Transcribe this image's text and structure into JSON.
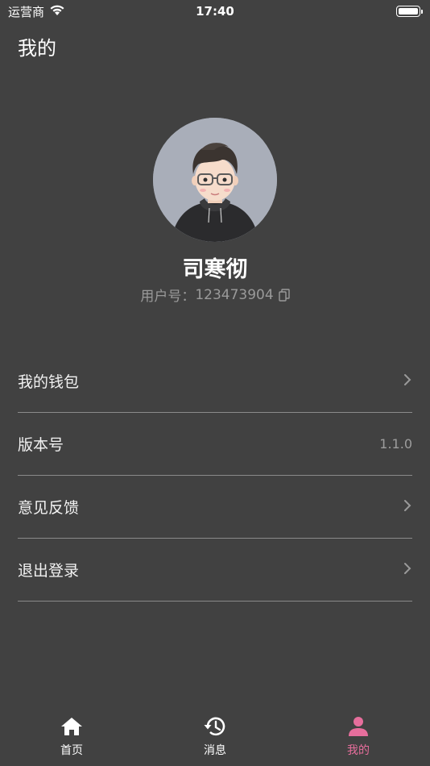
{
  "status_bar": {
    "carrier": "运营商",
    "time": "17:40",
    "battery_level": 1.0
  },
  "page": {
    "title": "我的"
  },
  "profile": {
    "username": "司寒彻",
    "user_id_label": "用户号：",
    "user_id": "123473904"
  },
  "menu": {
    "wallet": "我的钱包",
    "version_label": "版本号",
    "version_value": "1.1.0",
    "feedback": "意见反馈",
    "logout": "退出登录"
  },
  "tabs": {
    "home": "首页",
    "messages": "消息",
    "mine": "我的"
  },
  "colors": {
    "background": "#414141",
    "accent": "#e66e9c",
    "divider": "#8a8a8a"
  }
}
